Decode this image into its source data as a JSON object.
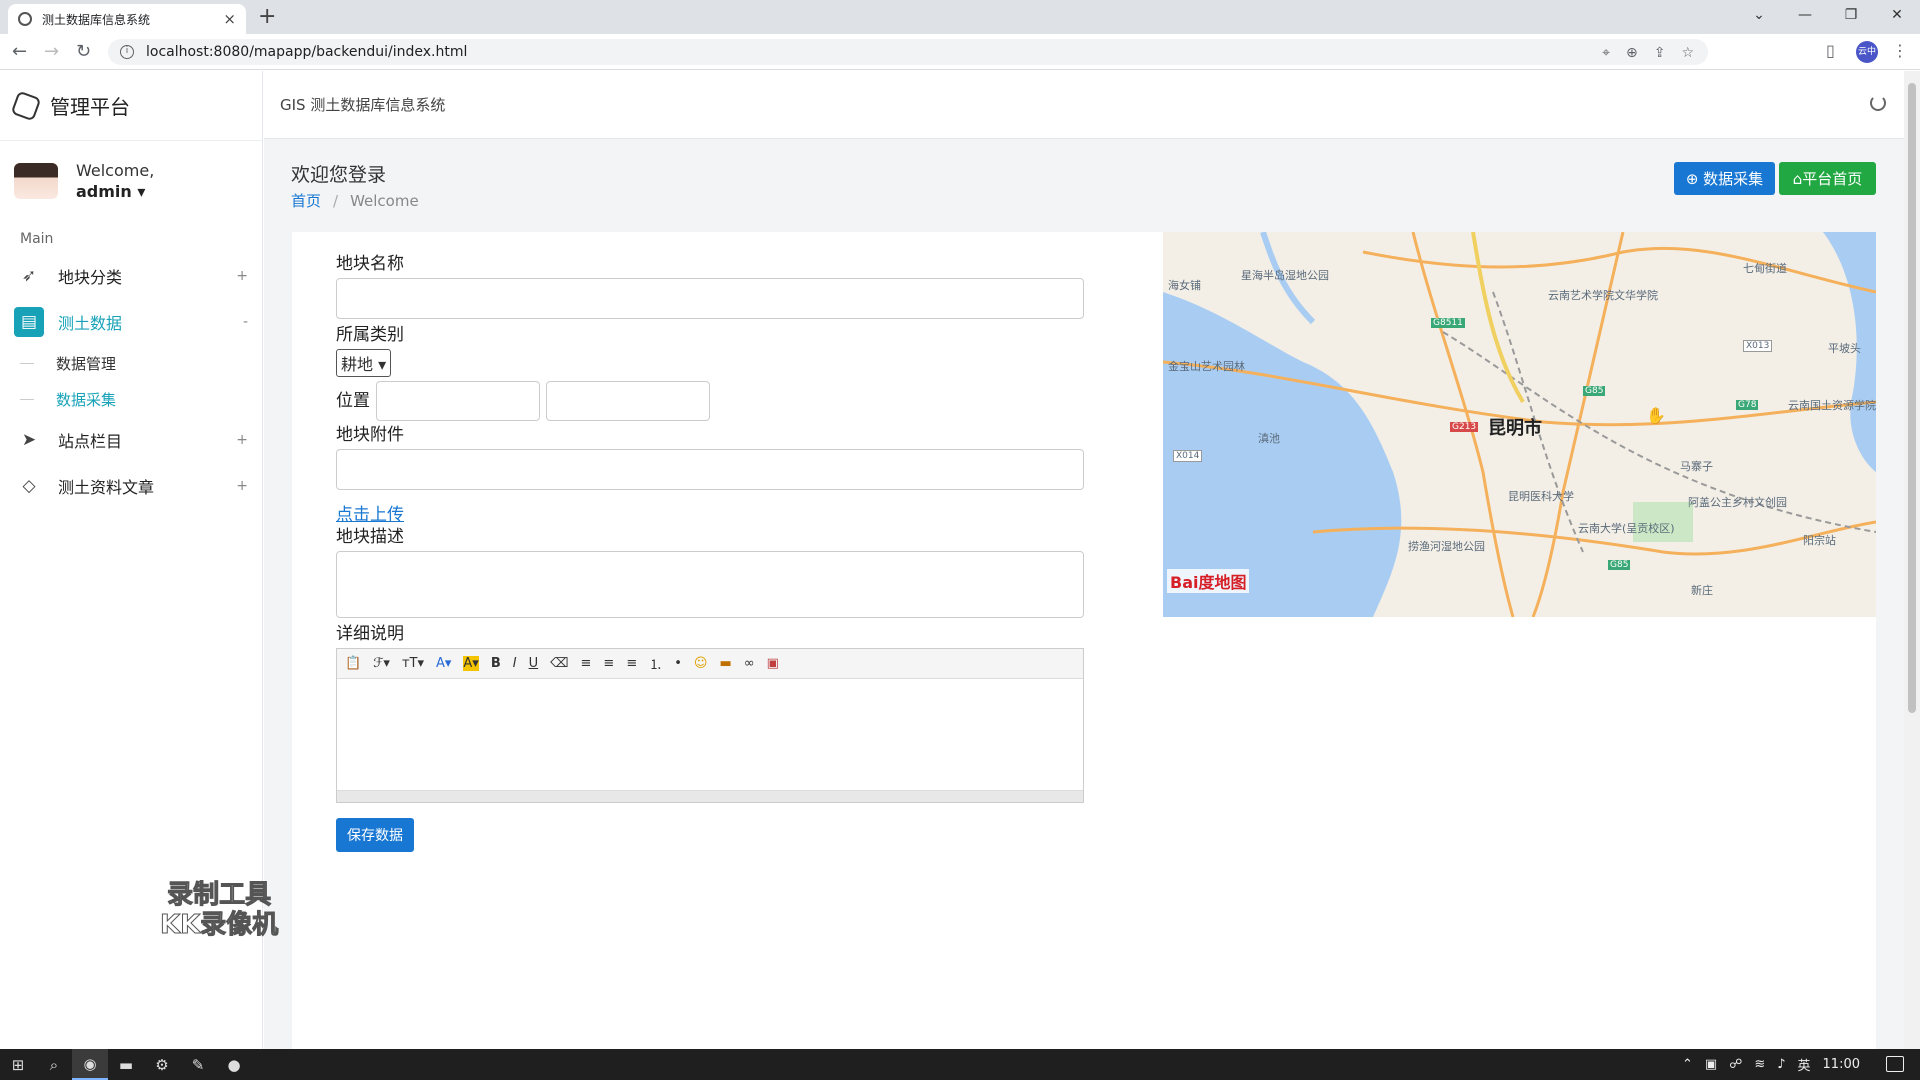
{
  "browser": {
    "tab_title": "测土数据库信息系统",
    "tab_close": "×",
    "new_tab": "+",
    "url": "localhost:8080/mapapp/backendui/index.html",
    "profile": "云中"
  },
  "sidebar": {
    "brand": "管理平台",
    "welcome": "Welcome,",
    "username": "admin ▾",
    "section": "Main",
    "items": [
      {
        "label": "地块分类",
        "toggle": "+"
      },
      {
        "label": "测土数据",
        "toggle": "-"
      },
      {
        "label": "站点栏目",
        "toggle": "+"
      },
      {
        "label": "测土资料文章",
        "toggle": "+"
      }
    ],
    "subitems": [
      {
        "label": "数据管理"
      },
      {
        "label": "数据采集"
      }
    ]
  },
  "topbar": {
    "title": "GIS 测土数据库信息系统"
  },
  "page": {
    "title": "欢迎您登录",
    "breadcrumb_home": "首页",
    "breadcrumb_sep": "/",
    "breadcrumb_current": "Welcome",
    "btn_collect": "⊕ 数据采集",
    "btn_home": "⌂平台首页"
  },
  "form": {
    "name_label": "地块名称",
    "category_label": "所属类别",
    "category_value": "耕地 ▾",
    "position_label": "位置",
    "attachment_label": "地块附件",
    "upload_link": "点击上传",
    "desc_label": "地块描述",
    "detail_label": "详细说明",
    "save_button": "保存数据",
    "toolbar": [
      "📋",
      "ℱ▾",
      "ᴛT▾",
      "A▾",
      "A▾",
      "B",
      "I",
      "U",
      "⌫",
      "≡",
      "≡",
      "≡",
      "⒈",
      "•",
      "☺",
      "▬",
      "∞",
      "▣"
    ]
  },
  "map": {
    "city": "昆明市",
    "labels": [
      "星海半岛湿地公园",
      "云南艺术学院文华学院",
      "七甸街道",
      "金宝山艺术园林",
      "滇池",
      "昆明医科大学",
      "马寨子",
      "阿盖公主乡村文创园",
      "云南大学(呈贡校区)",
      "捞渔河湿地公园",
      "阳宗站",
      "新庄",
      "云南国土资源学院(阳宗海校区)",
      "平坡头",
      "海女铺"
    ],
    "logo": "Bai度地图",
    "road_tags": [
      "G8511",
      "G213",
      "G85",
      "G78",
      "X013",
      "X014",
      "G85"
    ]
  },
  "watermark": {
    "line1": "录制工具",
    "line2": "KK录像机"
  },
  "taskbar": {
    "time": "11:00",
    "ime": "英"
  },
  "colors": {
    "accent": "#17a2b8",
    "primary": "#1877d2",
    "success": "#22a843"
  }
}
